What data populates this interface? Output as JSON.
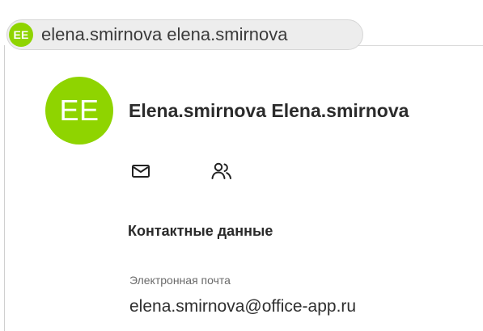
{
  "colors": {
    "avatar_bg": "#8fd400",
    "chip_bg": "#ededed"
  },
  "chip": {
    "avatar_initials": "EE",
    "name": "elena.smirnova elena.smirnova"
  },
  "profile": {
    "avatar_initials": "EE",
    "full_name": "Elena.smirnova Elena.smirnova",
    "actions": [
      {
        "icon": "mail-icon"
      },
      {
        "icon": "people-icon"
      }
    ]
  },
  "contact_section": {
    "title": "Контактные данные",
    "email_label": "Электронная почта",
    "email_value": "elena.smirnova@office-app.ru"
  }
}
